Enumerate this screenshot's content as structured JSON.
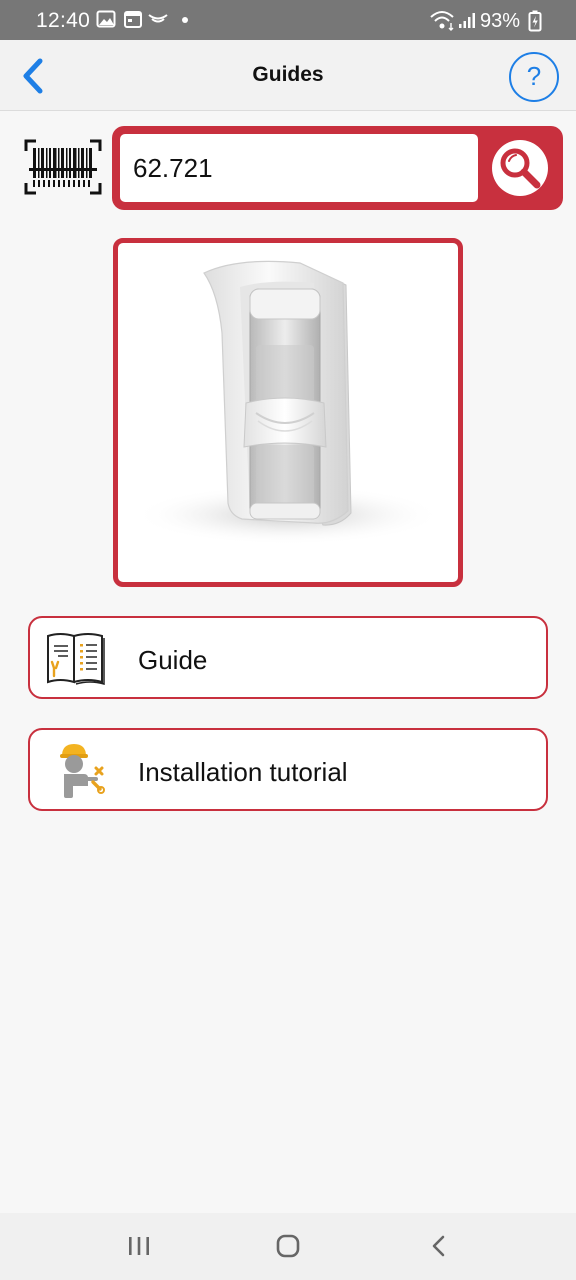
{
  "status_bar": {
    "time": "12:40",
    "battery": "93%",
    "icons": [
      "gallery-icon",
      "calendar-icon",
      "signal-icon",
      "dot-icon",
      "wifi-icon",
      "cell-signal-icon",
      "battery-icon"
    ]
  },
  "app_bar": {
    "title": "Guides",
    "back_icon": "chevron-left-icon",
    "help_label": "?",
    "accent_color": "#1e7fe6"
  },
  "search": {
    "value": "62.721",
    "scan_icon": "barcode-scan-icon",
    "search_icon": "magnifier-icon",
    "accent_color": "#c8303e"
  },
  "product": {
    "image_icon": "motion-detector-image"
  },
  "actions": [
    {
      "label": "Guide",
      "icon": "manual-book-icon"
    },
    {
      "label": "Installation tutorial",
      "icon": "installer-worker-icon"
    }
  ],
  "nav_bar": {
    "icons": [
      "recent-apps-icon",
      "home-icon",
      "back-icon"
    ]
  }
}
